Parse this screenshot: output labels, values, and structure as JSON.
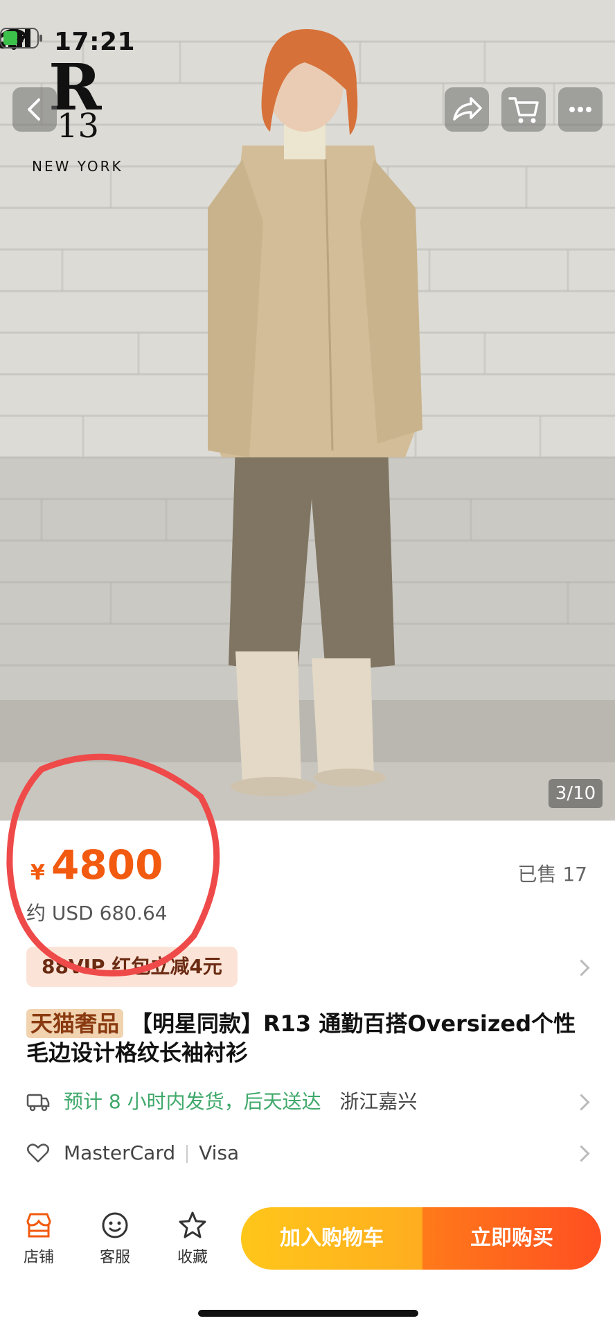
{
  "status_bar": {
    "time": "17:21"
  },
  "brand": {
    "logo_letter": "R",
    "logo_number": "13",
    "logo_city": "NEW YORK"
  },
  "gallery": {
    "counter": "3/10"
  },
  "price": {
    "symbol": "¥",
    "value": "4800",
    "usd": "约 USD 680.64",
    "sold": "已售 17"
  },
  "promo": {
    "vip": "88VIP 红包立减4元"
  },
  "product": {
    "badge": "天猫奢品",
    "title": "【明星同款】R13 通勤百搭Oversized个性毛边设计格纹长袖衬衫"
  },
  "shipping": {
    "estimate": "预计 8 小时内发货，后天送达",
    "origin": "浙江嘉兴"
  },
  "payment": {
    "card1": "MasterCard",
    "card2": "Visa"
  },
  "bottom_bar": {
    "store": "店铺",
    "service": "客服",
    "favorite": "收藏",
    "add_to_cart": "加入购物车",
    "buy_now": "立即购买"
  },
  "colors": {
    "price": "#f25a0f",
    "green_text": "#3fa86a",
    "cta_yellow": "#ffc61a",
    "cta_orange": "#ff4f21"
  }
}
